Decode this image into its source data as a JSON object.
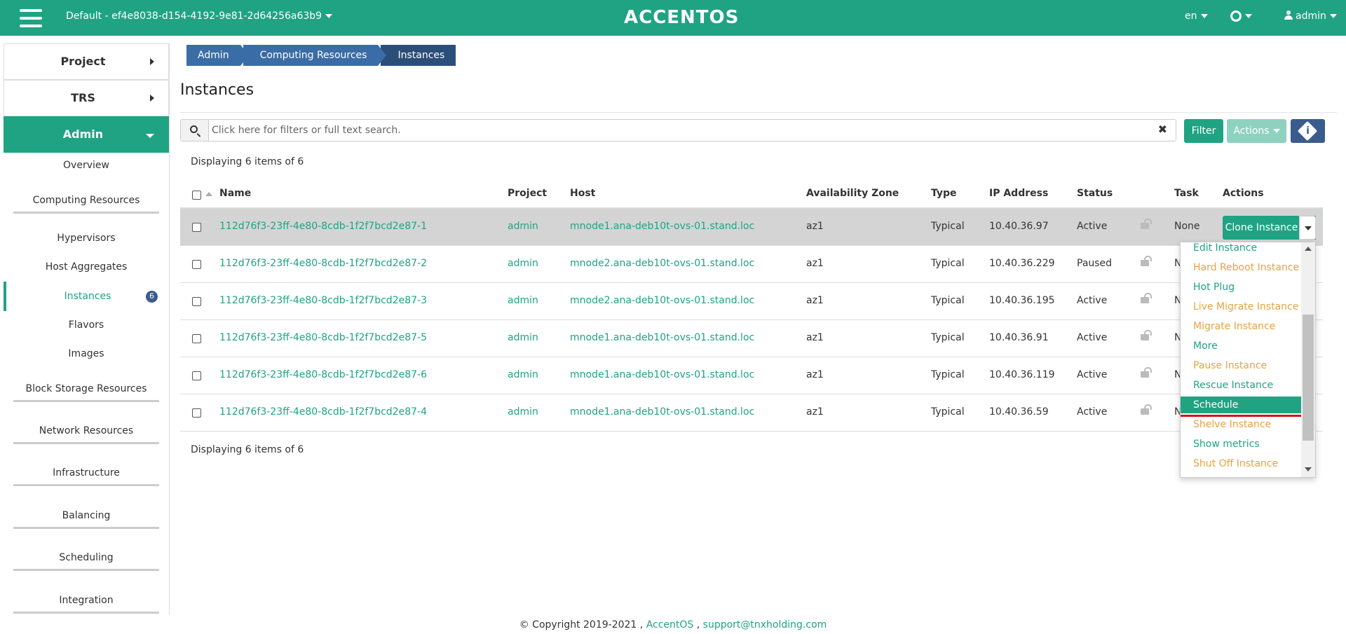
{
  "topbar": {
    "project": "Default - ef4e8038-d154-4192-9e81-2d64256a63b9",
    "logo": "ACCENTOS",
    "lang": "en",
    "user": "admin"
  },
  "sidebar": {
    "sections": [
      {
        "label": "Project"
      },
      {
        "label": "TRS"
      },
      {
        "label": "Admin"
      }
    ],
    "items": [
      {
        "label": "Overview"
      },
      {
        "label": "Computing Resources"
      },
      {
        "label": "Hypervisors"
      },
      {
        "label": "Host Aggregates"
      },
      {
        "label": "Instances",
        "badge": "6"
      },
      {
        "label": "Flavors"
      },
      {
        "label": "Images"
      },
      {
        "label": "Block Storage Resources"
      },
      {
        "label": "Network Resources"
      },
      {
        "label": "Infrastructure"
      },
      {
        "label": "Balancing"
      },
      {
        "label": "Scheduling"
      },
      {
        "label": "Integration"
      }
    ]
  },
  "breadcrumb": [
    "Admin",
    "Computing Resources",
    "Instances"
  ],
  "page_title": "Instances",
  "search": {
    "placeholder": "Click here for filters or full text search."
  },
  "buttons": {
    "filter": "Filter",
    "actions": "Actions",
    "info_icon": "i"
  },
  "display_count": "Displaying 6 items of 6",
  "table": {
    "columns": [
      "Name",
      "Project",
      "Host",
      "Availability Zone",
      "Type",
      "IP Address",
      "Status",
      "Task",
      "Actions"
    ],
    "rows": [
      {
        "name": "112d76f3-23ff-4e80-8cdb-1f2f7bcd2e87-1",
        "project": "admin",
        "host": "mnode1.ana-deb10t-ovs-01.stand.loc",
        "az": "az1",
        "type": "Typical",
        "ip": "10.40.36.97",
        "status": "Active",
        "task": "None"
      },
      {
        "name": "112d76f3-23ff-4e80-8cdb-1f2f7bcd2e87-2",
        "project": "admin",
        "host": "mnode2.ana-deb10t-ovs-01.stand.loc",
        "az": "az1",
        "type": "Typical",
        "ip": "10.40.36.229",
        "status": "Paused",
        "task": "N"
      },
      {
        "name": "112d76f3-23ff-4e80-8cdb-1f2f7bcd2e87-3",
        "project": "admin",
        "host": "mnode2.ana-deb10t-ovs-01.stand.loc",
        "az": "az1",
        "type": "Typical",
        "ip": "10.40.36.195",
        "status": "Active",
        "task": "N"
      },
      {
        "name": "112d76f3-23ff-4e80-8cdb-1f2f7bcd2e87-5",
        "project": "admin",
        "host": "mnode1.ana-deb10t-ovs-01.stand.loc",
        "az": "az1",
        "type": "Typical",
        "ip": "10.40.36.91",
        "status": "Active",
        "task": "N"
      },
      {
        "name": "112d76f3-23ff-4e80-8cdb-1f2f7bcd2e87-6",
        "project": "admin",
        "host": "mnode1.ana-deb10t-ovs-01.stand.loc",
        "az": "az1",
        "type": "Typical",
        "ip": "10.40.36.119",
        "status": "Active",
        "task": "N"
      },
      {
        "name": "112d76f3-23ff-4e80-8cdb-1f2f7bcd2e87-4",
        "project": "admin",
        "host": "mnode1.ana-deb10t-ovs-01.stand.loc",
        "az": "az1",
        "type": "Typical",
        "ip": "10.40.36.59",
        "status": "Active",
        "task": "N"
      }
    ]
  },
  "row_action": "Clone Instance",
  "menu": [
    {
      "label": "Edit Instance",
      "kind": "ok"
    },
    {
      "label": "Hard Reboot Instance",
      "kind": "warn"
    },
    {
      "label": "Hot Plug",
      "kind": "ok"
    },
    {
      "label": "Live Migrate Instance",
      "kind": "warn"
    },
    {
      "label": "Migrate Instance",
      "kind": "warn"
    },
    {
      "label": "More",
      "kind": "ok"
    },
    {
      "label": "Pause Instance",
      "kind": "warn"
    },
    {
      "label": "Rescue Instance",
      "kind": "ok"
    },
    {
      "label": "Schedule",
      "kind": "hl"
    },
    {
      "label": "Shelve Instance",
      "kind": "warn"
    },
    {
      "label": "Show metrics",
      "kind": "ok"
    },
    {
      "label": "Shut Off Instance",
      "kind": "warn"
    }
  ],
  "footer": {
    "copyright": "© Copyright 2019-2021 , ",
    "brand": "AccentOS",
    "sep": " , ",
    "email": "support@tnxholding.com"
  },
  "colors": {
    "accent": "#1fa383",
    "navy": "#3a5b8d",
    "warning": "#e8a33d"
  }
}
